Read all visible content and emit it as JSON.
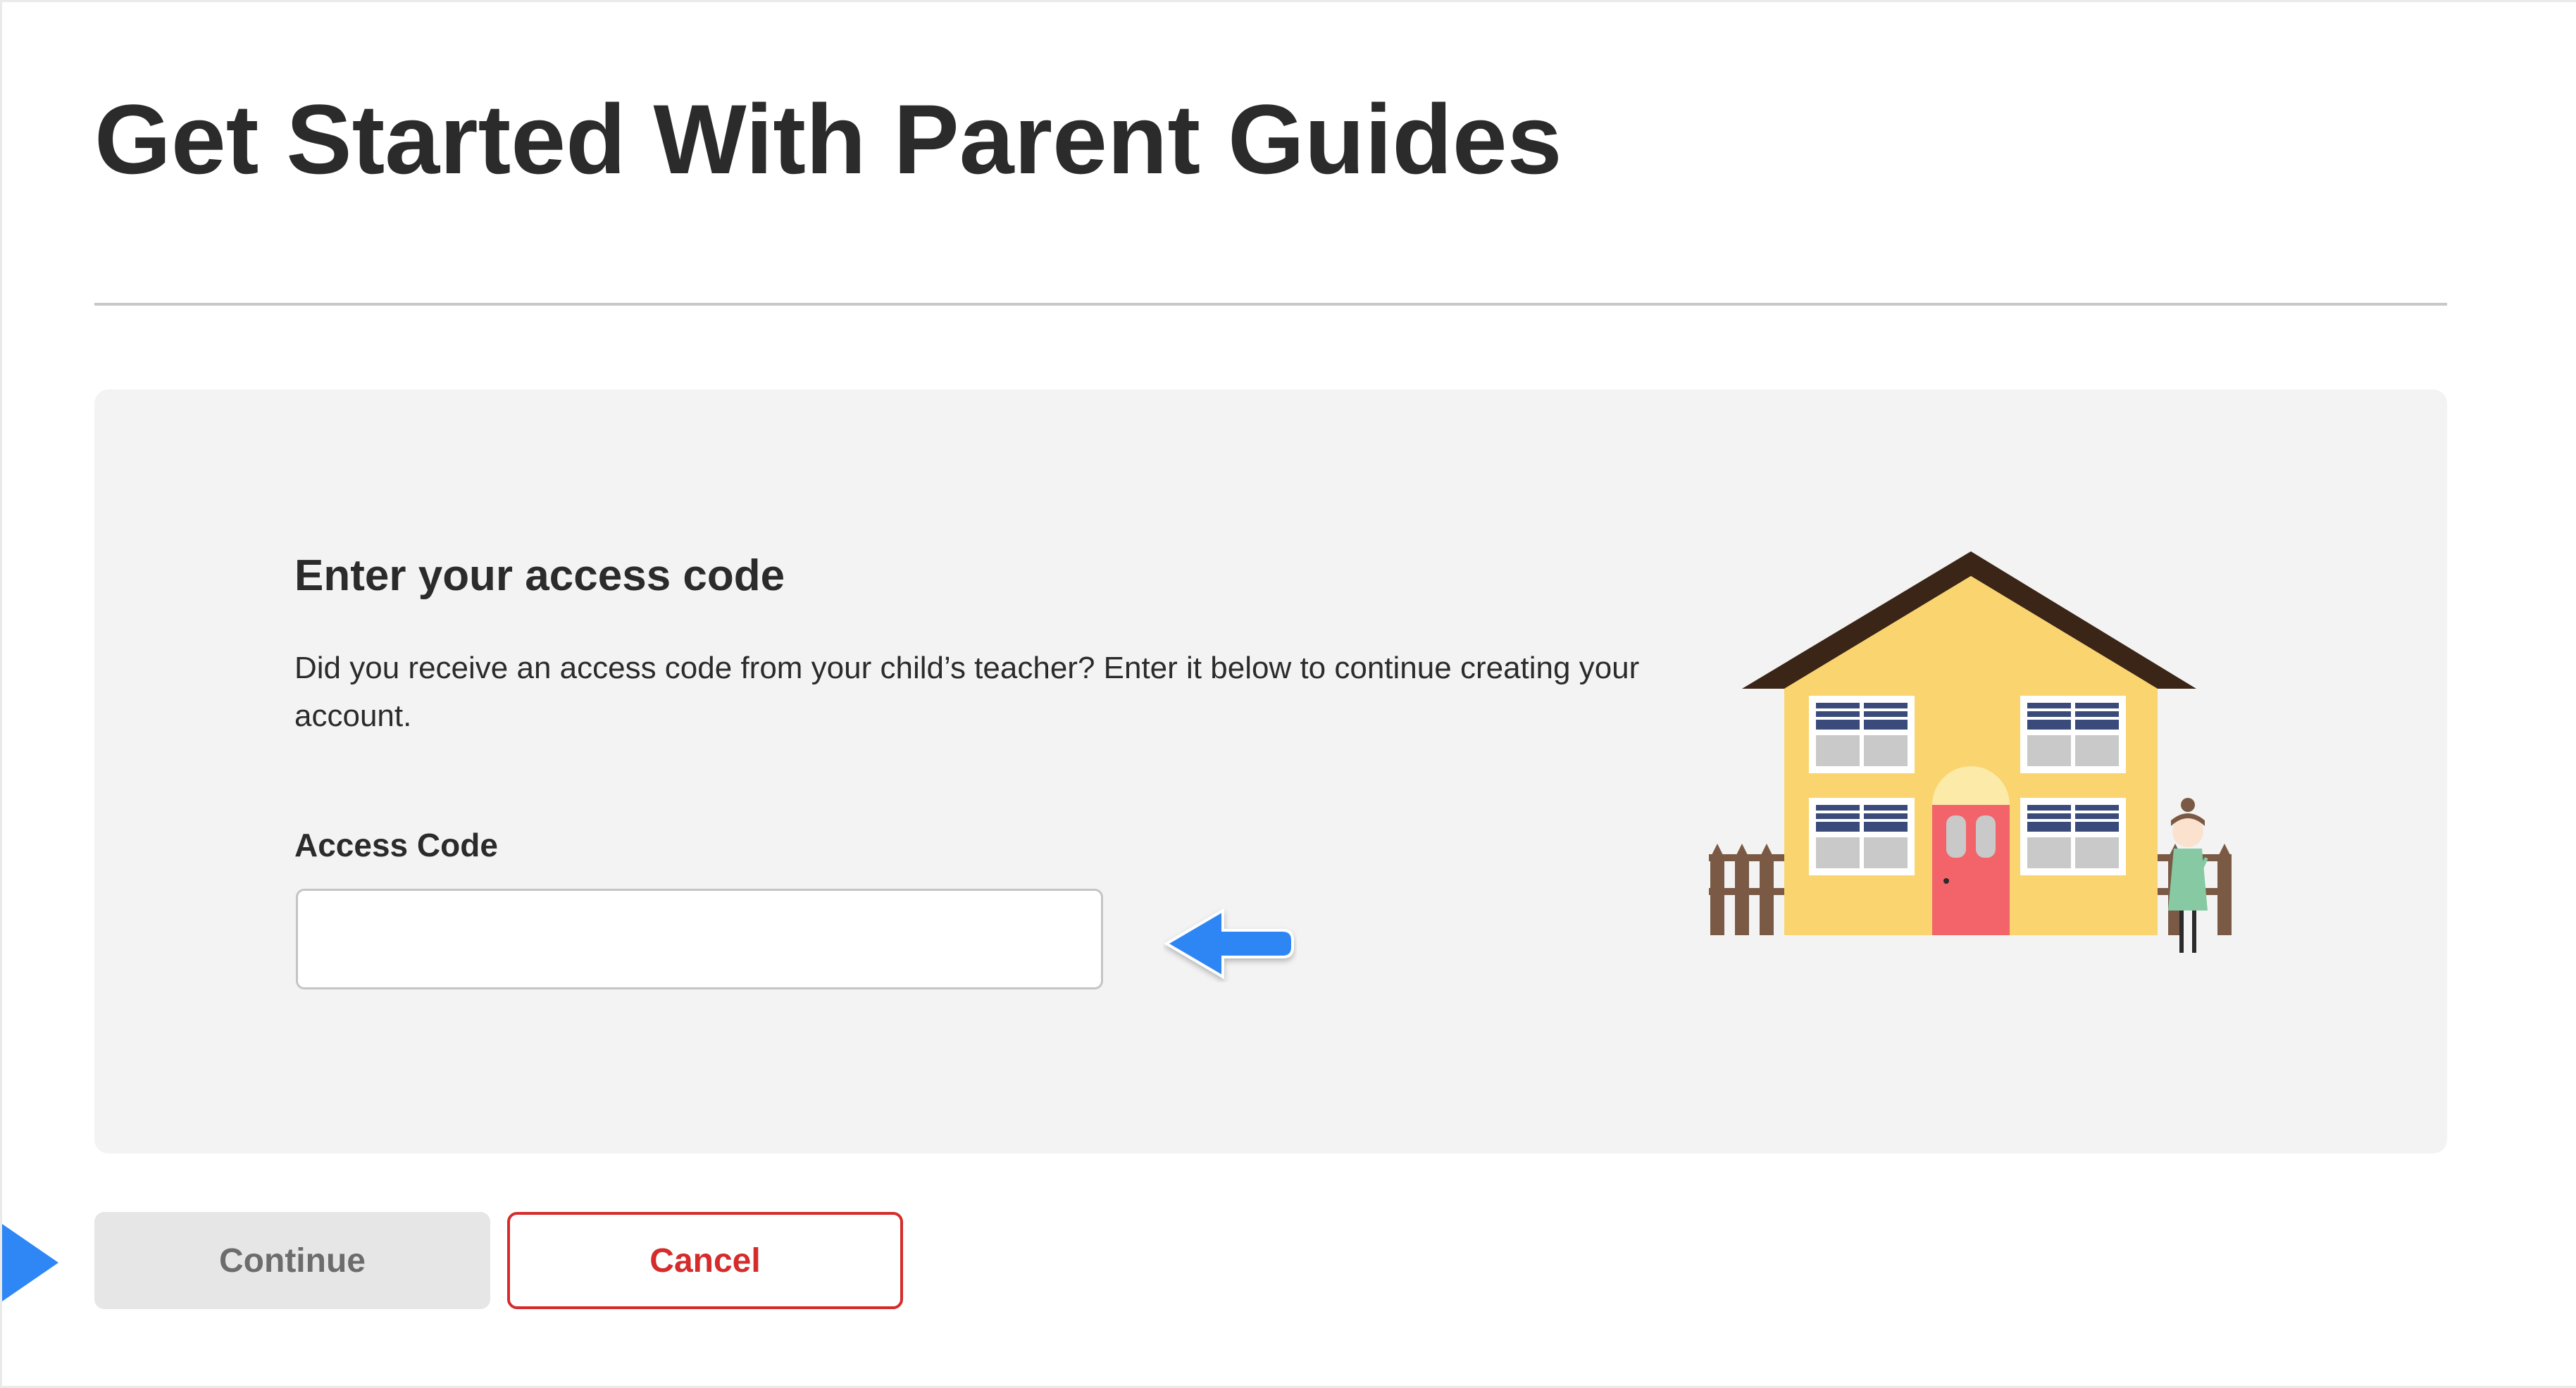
{
  "page": {
    "title": "Get Started With Parent Guides"
  },
  "card": {
    "heading": "Enter your access code",
    "description": "Did you receive an access code from your child’s teacher? Enter it below to continue creating your account."
  },
  "access_code": {
    "label": "Access Code",
    "value": "",
    "placeholder": ""
  },
  "actions": {
    "continue_label": "Continue",
    "cancel_label": "Cancel"
  },
  "colors": {
    "text": "#2b2b2b",
    "card_background": "#f3f3f3",
    "cancel_red": "#d52b2b",
    "continue_disabled": "#e6e6e6",
    "pointer_blue": "#2f86f5",
    "house_yellow": "#fad46e",
    "roof_brown": "#3a2516",
    "door_pink": "#f2646a"
  },
  "icons": {
    "pointer_arrow": "arrow-left-icon",
    "side_pointer": "triangle-right-icon",
    "illustration": "house-illustration"
  }
}
